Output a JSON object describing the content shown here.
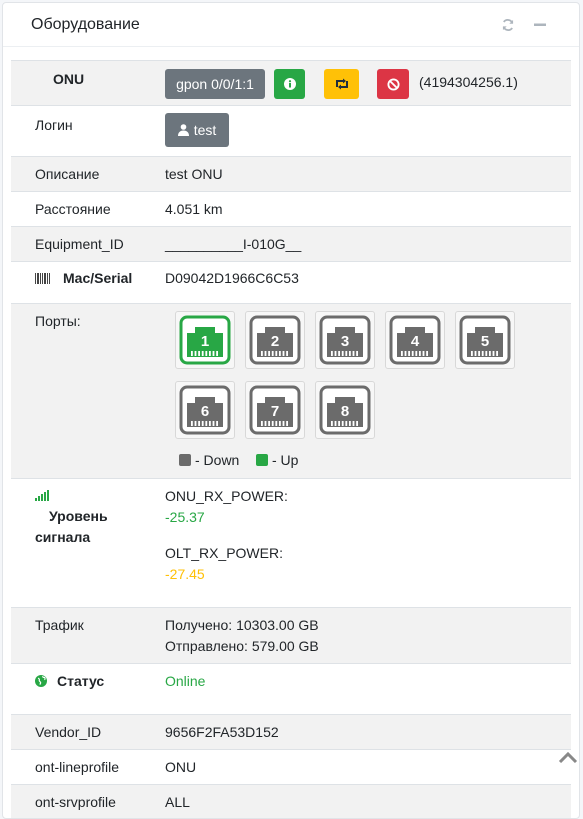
{
  "card": {
    "title": "Оборудование",
    "tools": {
      "refresh_icon": "refresh-icon",
      "collapse_icon": "minus-icon"
    }
  },
  "onu": {
    "label": "ONU",
    "port_button": "gpon 0/0/1:1",
    "info_icon": "info-icon",
    "reboot_icon": "retweet-icon",
    "block_icon": "ban-icon",
    "id_text": "(4194304256.1)"
  },
  "login": {
    "label": "Логин",
    "button": "test",
    "icon": "user-icon"
  },
  "description": {
    "label": "Описание",
    "value": "test ONU"
  },
  "distance": {
    "label": "Расстояние",
    "value": "4.051 km"
  },
  "equipment": {
    "label": "Equipment_ID",
    "value": "__________I-010G__"
  },
  "mac": {
    "label": "Mac/Serial",
    "icon": "barcode-icon",
    "value": "D09042D1966C6C53"
  },
  "ports": {
    "label": "Порты:",
    "items": [
      {
        "number": "1",
        "state": "up"
      },
      {
        "number": "2",
        "state": "down"
      },
      {
        "number": "3",
        "state": "down"
      },
      {
        "number": "4",
        "state": "down"
      },
      {
        "number": "5",
        "state": "down"
      },
      {
        "number": "6",
        "state": "down"
      },
      {
        "number": "7",
        "state": "down"
      },
      {
        "number": "8",
        "state": "down"
      }
    ],
    "legend_down": "- Down",
    "legend_up": "- Up",
    "colors": {
      "up": "#28a745",
      "down": "#6b6b6b"
    }
  },
  "signal": {
    "label_line1": "Уровень",
    "label_line2": "сигнала",
    "icon": "signal-icon",
    "onu_rx_label": "ONU_RX_POWER:",
    "onu_rx_value": "-25.37",
    "olt_rx_label": "OLT_RX_POWER:",
    "olt_rx_value": "-27.45"
  },
  "traffic": {
    "label": "Трафик",
    "received": "Получено: 10303.00 GB",
    "sent": "Отправлено: 579.00 GB"
  },
  "status": {
    "label": "Статус",
    "icon": "globe-icon",
    "value": "Online"
  },
  "vendor": {
    "label": "Vendor_ID",
    "value": "9656F2FA53D152"
  },
  "lineprofile": {
    "label": "ont-lineprofile",
    "value": "ONU"
  },
  "srvprofile": {
    "label": "ont-srvprofile",
    "value": "ALL"
  },
  "scroll_top_icon": "chevron-up-icon"
}
